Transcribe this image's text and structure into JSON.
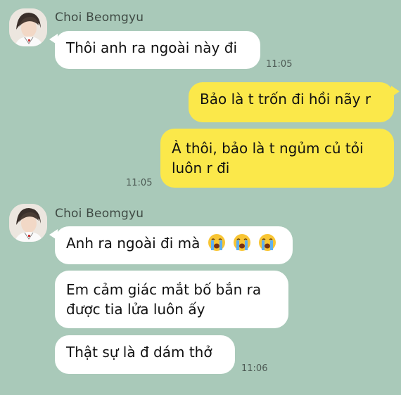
{
  "chat": {
    "sender_name": "Choi Beomgyu",
    "groups": [
      {
        "sender": "Choi Beomgyu",
        "messages": [
          {
            "text": "Thôi anh ra ngoài này đi",
            "time": "11:05"
          }
        ]
      },
      {
        "sender": "me",
        "messages": [
          {
            "text": "Bảo là t trốn đi hồi nãy r"
          },
          {
            "text": "À thôi, bảo là t ngủm củ tỏi luôn r đi",
            "time": "11:05"
          }
        ]
      },
      {
        "sender": "Choi Beomgyu",
        "messages": [
          {
            "text": "Anh ra ngoài đi mà",
            "emoji": [
              "loudly-crying-face",
              "loudly-crying-face",
              "loudly-crying-face"
            ]
          },
          {
            "text": "Em cảm giác mắt bố bắn ra được tia lửa luôn ấy"
          },
          {
            "text": "Thật sự là đ dám thở",
            "time": "11:06"
          }
        ]
      }
    ]
  },
  "colors": {
    "background": "#a9c9b9",
    "incoming_bubble": "#ffffff",
    "outgoing_bubble": "#fbe84a"
  }
}
